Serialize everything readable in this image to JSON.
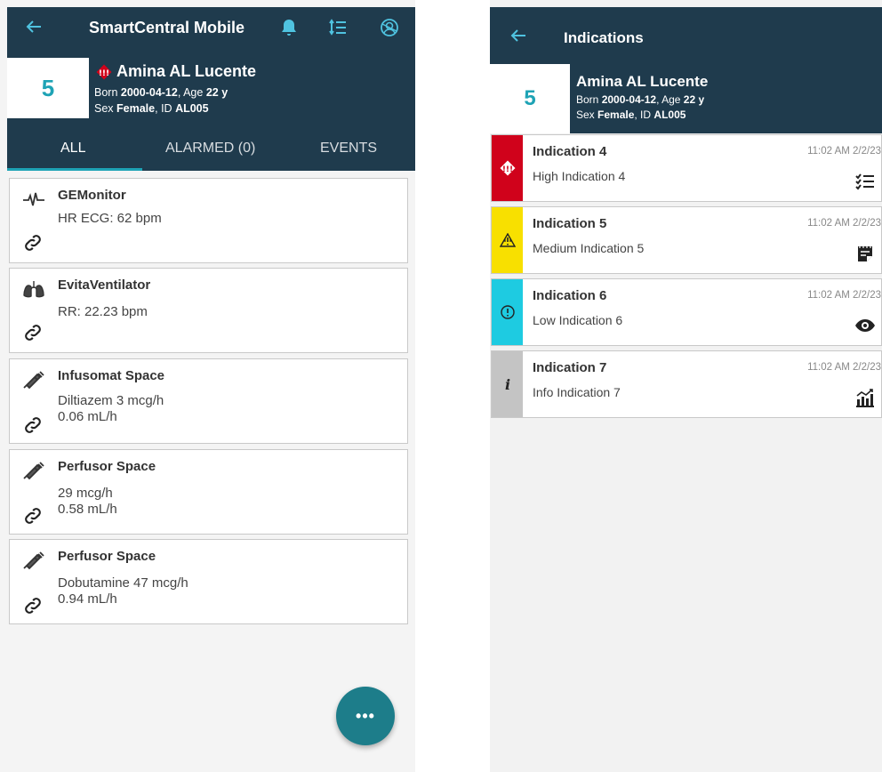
{
  "left": {
    "title": "SmartCentral Mobile",
    "patient": {
      "bed": "5",
      "name": "Amina AL Lucente",
      "born_label": "Born",
      "born": "2000-04-12",
      "age_label": ", Age",
      "age": "22 y",
      "sex_label": "Sex",
      "sex": "Female",
      "id_label": ", ID",
      "id": "AL005"
    },
    "tabs": [
      "ALL",
      "ALARMED (0)",
      "EVENTS"
    ],
    "devices": [
      {
        "name": "GEMonitor",
        "icon": "ecg-waveform-icon",
        "lines": [
          "HR ECG: 62 bpm"
        ]
      },
      {
        "name": "EvitaVentilator",
        "icon": "lungs-icon",
        "lines": [
          "RR: 22.23 bpm"
        ]
      },
      {
        "name": "Infusomat Space",
        "icon": "syringe-icon",
        "lines": [
          "Diltiazem 3 mcg/h",
          "0.06 mL/h"
        ]
      },
      {
        "name": "Perfusor Space",
        "icon": "syringe-icon",
        "lines": [
          "29 mcg/h",
          "0.58 mL/h"
        ]
      },
      {
        "name": "Perfusor Space",
        "icon": "syringe-icon",
        "lines": [
          "Dobutamine 47 mcg/h",
          "0.94 mL/h"
        ]
      }
    ],
    "fab_label": "•••",
    "colors": {
      "header": "#1f3b4d",
      "accent": "#1ea3b5",
      "fab": "#1d7d8a"
    }
  },
  "right": {
    "title": "Indications",
    "patient": {
      "bed": "5",
      "name": "Amina AL Lucente",
      "born_label": "Born",
      "born": "2000-04-12",
      "age_label": ", Age",
      "age": "22 y",
      "sex_label": "Sex",
      "sex": "Female",
      "id_label": ", ID",
      "id": "AL005"
    },
    "indications": [
      {
        "title": "Indication 4",
        "subtitle": "High Indication 4",
        "time": "11:02 AM 2/2/23",
        "level": "high",
        "color": "#d0021b",
        "action_icon": "checklist-icon"
      },
      {
        "title": "Indication 5",
        "subtitle": "Medium Indication 5",
        "time": "11:02 AM 2/2/23",
        "level": "medium",
        "color": "#f8e000",
        "action_icon": "notepad-icon"
      },
      {
        "title": "Indication 6",
        "subtitle": "Low Indication 6",
        "time": "11:02 AM 2/2/23",
        "level": "low",
        "color": "#1ecbe1",
        "action_icon": "eye-icon"
      },
      {
        "title": "Indication 7",
        "subtitle": "Info Indication 7",
        "time": "11:02 AM 2/2/23",
        "level": "info",
        "color": "#c4c4c4",
        "action_icon": "chart-icon"
      }
    ]
  }
}
